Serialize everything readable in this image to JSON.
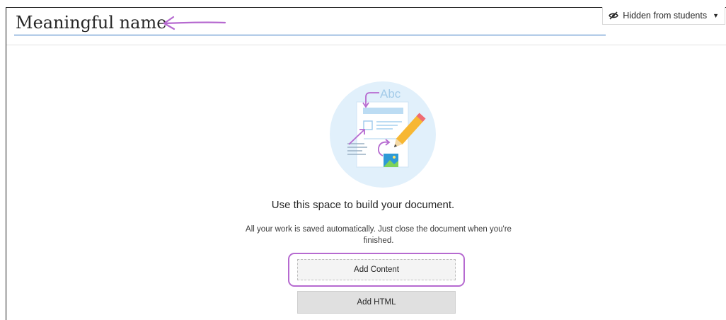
{
  "document": {
    "title": "Meaningful name"
  },
  "visibility": {
    "label": "Hidden from students",
    "icon": "eye-slash-icon",
    "caret_icon": "caret-down-icon"
  },
  "empty_state": {
    "illustration_text": "Abc",
    "headline": "Use this space to build your document.",
    "description": "All your work is saved automatically. Just close the document when you're finished."
  },
  "actions": {
    "add_content_label": "Add Content",
    "add_html_label": "Add HTML"
  },
  "colors": {
    "accent_underline": "#2f74c0",
    "annotation_purple": "#b66ad0",
    "illustration_bg": "#e1f0fb"
  }
}
